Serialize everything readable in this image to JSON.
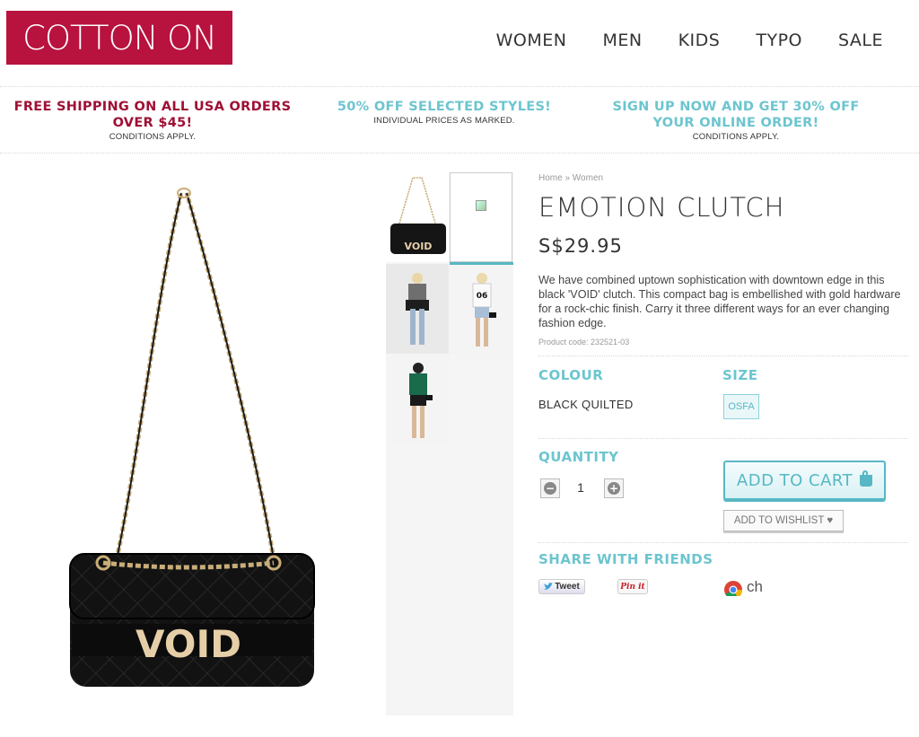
{
  "header": {
    "logo": "COTTON ON",
    "nav": [
      "WOMEN",
      "MEN",
      "KIDS",
      "TYPO",
      "SALE"
    ]
  },
  "promos": [
    {
      "line1": "FREE SHIPPING ON ALL USA ORDERS",
      "line2": "OVER $45!",
      "note": "CONDITIONS APPLY.",
      "color": "#9e1034"
    },
    {
      "line1": "50% OFF SELECTED STYLES!",
      "line2": "",
      "note": "INDIVIDUAL PRICES AS MARKED.",
      "color": "#6cc5cf"
    },
    {
      "line1": "SIGN UP NOW AND GET 30% OFF",
      "line2": "YOUR ONLINE ORDER!",
      "note": "CONDITIONS APPLY.",
      "color": "#6cc5cf"
    }
  ],
  "product": {
    "breadcrumb": "Home » Women",
    "title": "EMOTION CLUTCH",
    "price": "S$29.95",
    "description": "We have combined uptown sophistication with downtown edge in this black 'VOID' clutch. This compact bag is embellished with gold hardware for a rock-chic finish. Carry it three different ways for an ever changing fashion edge.",
    "code": "Product code: 232521-03",
    "bag_text": "VOID",
    "colour_label": "COLOUR",
    "colour_value": "BLACK QUILTED",
    "size_label": "SIZE",
    "size_value": "OSFA",
    "quantity_label": "QUANTITY",
    "quantity_value": "1",
    "add_to_cart": "ADD TO CART",
    "add_to_wishlist": "ADD TO WISHLIST ♥",
    "share_label": "SHARE WITH FRIENDS",
    "tweet": "Tweet",
    "pinit": "Pin it",
    "chrome_text": "ch"
  },
  "colors": {
    "brand": "#b8123e",
    "accent": "#6cc5cf"
  }
}
